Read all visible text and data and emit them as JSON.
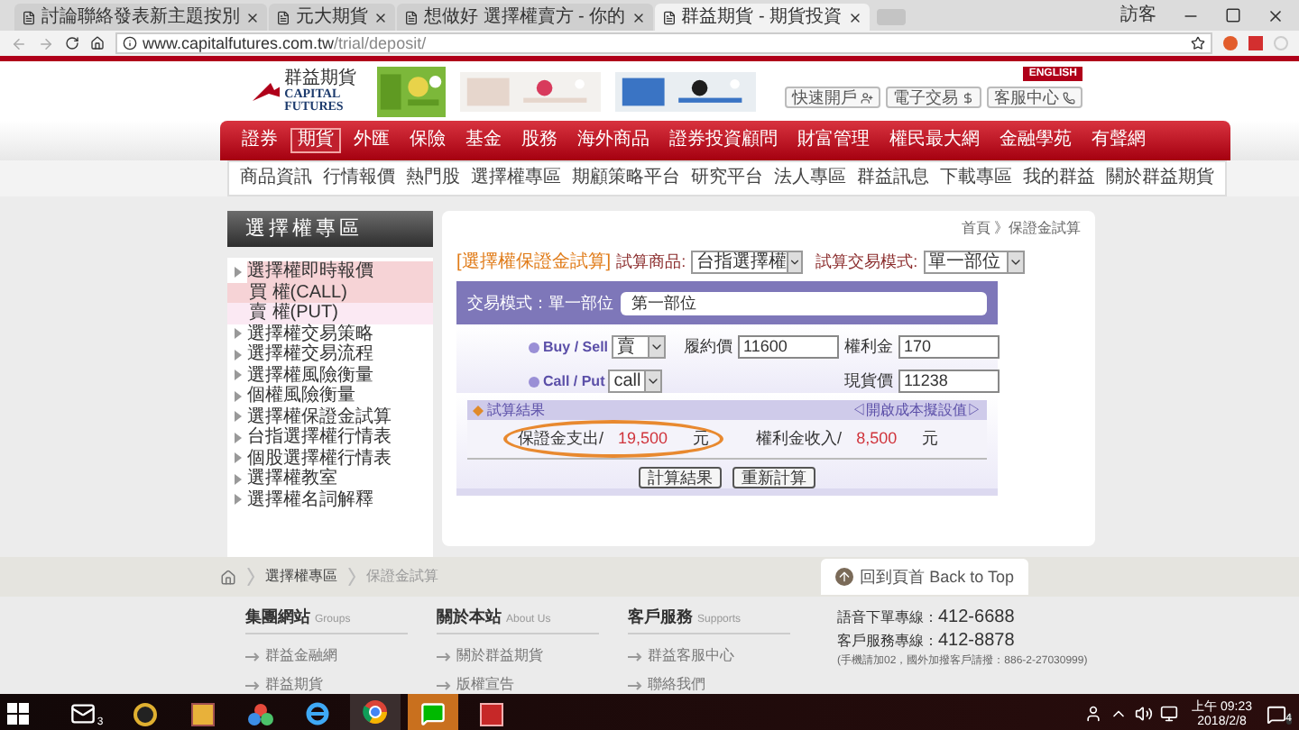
{
  "browser": {
    "tabs": [
      {
        "title": "討論聯絡發表新主題按別",
        "selected": false
      },
      {
        "title": "元大期貨",
        "selected": false
      },
      {
        "title": "想做好 選擇權賣方 - 你的",
        "selected": false
      },
      {
        "title": "群益期貨 - 期貨投資",
        "selected": true
      }
    ],
    "profile": "訪客",
    "url_host": "www.capitalfutures.com.tw",
    "url_path": "/trial/deposit/"
  },
  "header": {
    "logo_name": "群益期貨",
    "logo_en": "CAPITAL FUTURES",
    "language_link": "ENGLISH",
    "quick_buttons": [
      "快速開戶",
      "電子交易",
      "客服中心"
    ]
  },
  "main_nav": [
    {
      "label": "證券",
      "selected": false
    },
    {
      "label": "期貨",
      "selected": true
    },
    {
      "label": "外匯",
      "selected": false
    },
    {
      "label": "保險",
      "selected": false
    },
    {
      "label": "基金",
      "selected": false
    },
    {
      "label": "股務",
      "selected": false
    },
    {
      "label": "海外商品",
      "selected": false
    },
    {
      "label": "證券投資顧問",
      "selected": false
    },
    {
      "label": "財富管理",
      "selected": false
    },
    {
      "label": "權民最大網",
      "selected": false
    },
    {
      "label": "金融學苑",
      "selected": false
    },
    {
      "label": "有聲網",
      "selected": false
    }
  ],
  "sub_nav": [
    "商品資訊",
    "行情報價",
    "熱門股",
    "選擇權專區",
    "期顧策略平台",
    "研究平台",
    "法人專區",
    "群益訊息",
    "下載專區",
    "我的群益",
    "關於群益期貨"
  ],
  "sidebar": {
    "title": "選擇權專區",
    "items": [
      {
        "label": "選擇權即時報價",
        "selected": true,
        "children": [
          {
            "label": "買 權(CALL)",
            "selected": true
          },
          {
            "label": "賣 權(PUT)",
            "selected": false
          }
        ]
      },
      {
        "label": "選擇權交易策略",
        "selected": false
      },
      {
        "label": "選擇權交易流程",
        "selected": false
      },
      {
        "label": "選擇權風險衡量",
        "selected": false
      },
      {
        "label": "個權風險衡量",
        "selected": false
      },
      {
        "label": "選擇權保證金試算",
        "selected": false
      },
      {
        "label": "台指選擇權行情表",
        "selected": false
      },
      {
        "label": "個股選擇權行情表",
        "selected": false
      },
      {
        "label": "選擇權教室",
        "selected": false
      },
      {
        "label": "選擇權名詞解釋",
        "selected": false
      }
    ]
  },
  "breadcrumb": "首頁 》保證金試算",
  "calculator": {
    "title": "[選擇權保證金試算]",
    "product_label": "試算商品:",
    "product": "台指選擇權",
    "mode_label": "試算交易模式:",
    "mode": "單一部位",
    "panel_heading": "交易模式：單一部位",
    "position_tab": "第一部位",
    "buy_sell": {
      "label": "Buy / Sell",
      "value": "賣"
    },
    "call_put": {
      "label": "Call / Put",
      "value": "call"
    },
    "strike": {
      "label": "履約價",
      "value": "11600"
    },
    "premium": {
      "label": "權利金",
      "value": "170"
    },
    "spot": {
      "label": "現貨價",
      "value": "11238"
    },
    "result_heading": "試算結果",
    "cost_link": "◁開啟成本擬設值▷",
    "results": [
      {
        "label": "保證金支出/",
        "value": "19,500",
        "unit": "元",
        "highlighted": true
      },
      {
        "label": "權利金收入/",
        "value": "8,500",
        "unit": "元",
        "highlighted": false
      }
    ],
    "buttons": [
      "計算結果",
      "重新計算"
    ]
  },
  "footer": {
    "breadcrumb": [
      "選擇權專區",
      "保證金試算"
    ],
    "back_to_top": "回到頁首",
    "back_to_top_en": "Back to Top",
    "columns": [
      {
        "title": "集團網站",
        "title_en": "Groups",
        "links": [
          "群益金融網",
          "群益期貨"
        ]
      },
      {
        "title": "關於本站",
        "title_en": "About Us",
        "links": [
          "關於群益期貨",
          "版權宣告"
        ]
      },
      {
        "title": "客戶服務",
        "title_en": "Supports",
        "links": [
          "群益客服中心",
          "聯絡我們"
        ]
      }
    ],
    "hotlines": [
      {
        "label": "語音下單專線：",
        "number": "412-6688"
      },
      {
        "label": "客戶服務專線：",
        "number": "412-8878"
      }
    ],
    "note": "(手機請加02，國外加撥客戶請撥：886-2-27030999)"
  },
  "taskbar": {
    "apps": [
      {
        "kind": "mail",
        "selected": false,
        "attention": false
      },
      {
        "kind": "clock",
        "selected": false,
        "attention": false
      },
      {
        "kind": "paint",
        "selected": false,
        "attention": false
      },
      {
        "kind": "colors",
        "selected": false,
        "attention": false
      },
      {
        "kind": "ie",
        "selected": false,
        "attention": false
      },
      {
        "kind": "chrome",
        "selected": true,
        "attention": false
      },
      {
        "kind": "line",
        "selected": false,
        "attention": true
      },
      {
        "kind": "red",
        "selected": false,
        "attention": false
      }
    ],
    "mail_badge": "3",
    "time": "上午 09:23",
    "date": "2018/2/8",
    "notifications": "4"
  }
}
